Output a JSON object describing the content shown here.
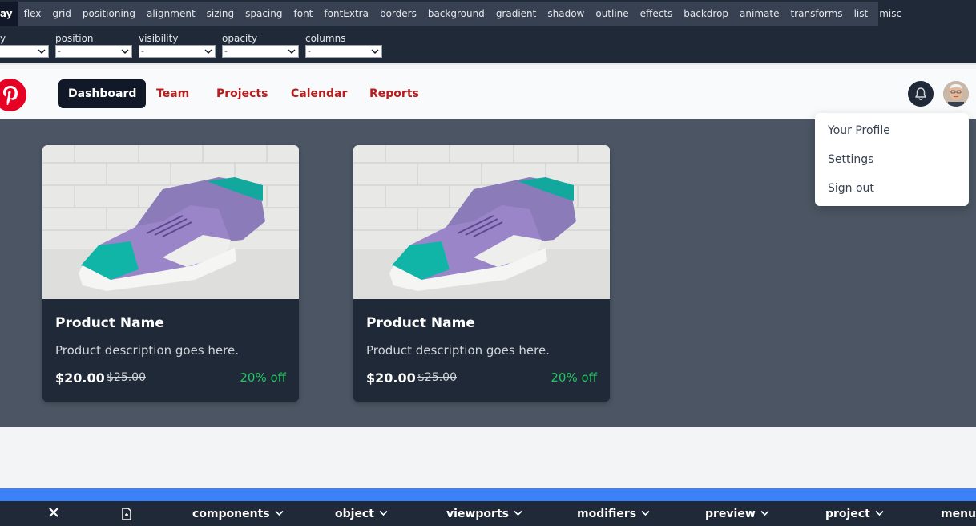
{
  "editor": {
    "tabs": [
      {
        "label": "ay",
        "active": true
      },
      {
        "label": "flex"
      },
      {
        "label": "grid"
      },
      {
        "label": "positioning"
      },
      {
        "label": "alignment"
      },
      {
        "label": "sizing"
      },
      {
        "label": "spacing"
      },
      {
        "label": "font"
      },
      {
        "label": "fontExtra"
      },
      {
        "label": "borders"
      },
      {
        "label": "background"
      },
      {
        "label": "gradient"
      },
      {
        "label": "shadow"
      },
      {
        "label": "outline"
      },
      {
        "label": "effects"
      },
      {
        "label": "backdrop"
      },
      {
        "label": "animate"
      },
      {
        "label": "transforms"
      },
      {
        "label": "list"
      },
      {
        "label": "misc"
      }
    ],
    "props": [
      {
        "label": "y",
        "value": ""
      },
      {
        "label": "position",
        "value": "-"
      },
      {
        "label": "visibility",
        "value": "-"
      },
      {
        "label": "opacity",
        "value": "-"
      },
      {
        "label": "columns",
        "value": "-"
      }
    ]
  },
  "navbar": {
    "logo": "pinterest-logo",
    "links": [
      "Dashboard",
      "Team",
      "Projects",
      "Calendar",
      "Reports"
    ],
    "active_link": "Dashboard",
    "notification_icon": "bell-icon",
    "avatar_icon": "user-avatar"
  },
  "products": [
    {
      "name": "Product Name",
      "description": "Product description goes here.",
      "price": "$20.00",
      "old_price": "$25.00",
      "discount": "20% off"
    },
    {
      "name": "Product Name",
      "description": "Product description goes here.",
      "price": "$20.00",
      "old_price": "$25.00",
      "discount": "20% off"
    }
  ],
  "user_menu": [
    "Your Profile",
    "Settings",
    "Sign out"
  ],
  "bottom_bar": {
    "close_icon": "close-icon",
    "file_icon": "file-icon",
    "items": [
      "components",
      "object",
      "viewports",
      "modifiers",
      "preview",
      "project",
      "menu"
    ]
  },
  "colors": {
    "accent_link": "#b91c1c",
    "active_nav": "#111827",
    "discount": "#22c55e",
    "brand_logo": "#e60023",
    "bottom_strip": "#3b82f6"
  }
}
